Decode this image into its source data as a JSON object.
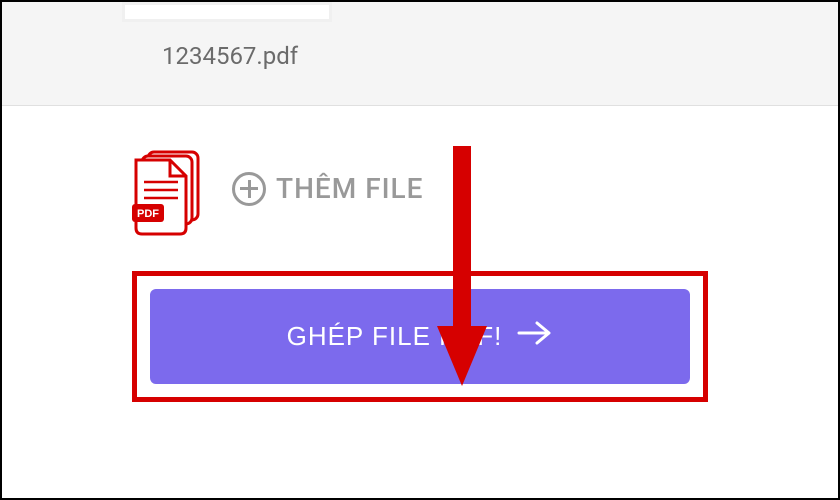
{
  "file": {
    "name": "1234567.pdf"
  },
  "addFile": {
    "label": "THÊM FILE"
  },
  "mergeButton": {
    "label": "GHÉP FILE PDF!"
  },
  "icons": {
    "pdfBadge": "PDF"
  }
}
